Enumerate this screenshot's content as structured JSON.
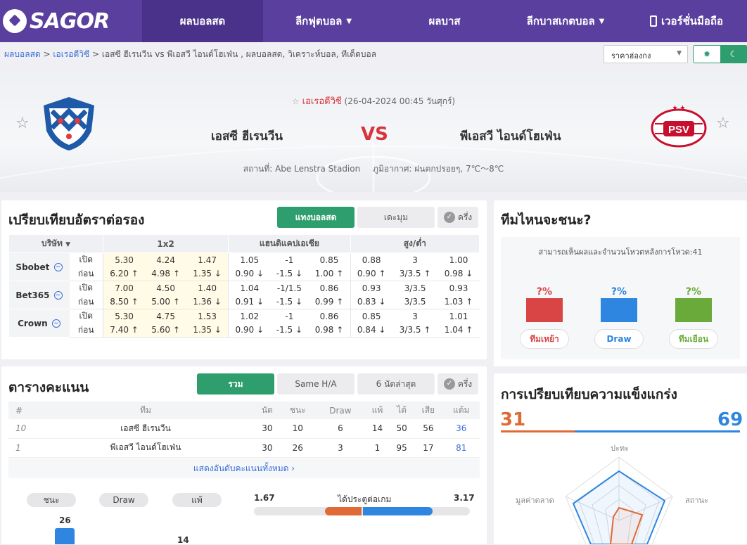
{
  "nav": {
    "logo": "SAGOR",
    "items": [
      {
        "label": "ผลบอลสด",
        "dropdown": false,
        "active": true
      },
      {
        "label": "ลีกฟุตบอล",
        "dropdown": true,
        "active": false
      },
      {
        "label": "ผลบาส",
        "dropdown": false,
        "active": false
      },
      {
        "label": "ลีกบาสเกตบอล",
        "dropdown": true,
        "active": false
      },
      {
        "label": "เวอร์ชั่นมือถือ",
        "dropdown": false,
        "active": false
      }
    ]
  },
  "breadcrumb": {
    "home": "ผลบอลสด",
    "league": "เอเรอดีวิซี",
    "rest": "> เอสซี ฮีเรนวีน vs พีเอสวี ไอนด์โฮเฟ่น , ผลบอลสด, วิเคราะห์บอล, ทีเด็ดบอล",
    "odds_type": "ราคาฮ่องกง"
  },
  "match": {
    "league": "เอเรอดีวิซี",
    "datetime": "(26-04-2024 00:45 วันศุกร์)",
    "home": "เอสซี ฮีเรนวีน",
    "away": "พีเอสวี ไอนด์โฮเฟ่น",
    "vs": "VS",
    "venue": "สถานที่: Abe Lenstra Stadion",
    "weather": "ภูมิอากาศ: ฝนตกปรอยๆ, 7℃～8℃",
    "home_crest_text": "SC Heerenveen",
    "away_crest_text": "PSV"
  },
  "odds": {
    "title": "เปรียบเทียบอัตราต่อรอง",
    "btn_live": "แทงบอลสด",
    "btn_more": "เดะมุม",
    "btn_half": "ครึ่ง",
    "headers": {
      "company": "บริษัท",
      "x12": "1x2",
      "handicap": "แฮนดิแคปเอเชีย",
      "ou": "สูง/ต่ำ"
    },
    "open_label": "เปิด",
    "close_label": "ก่อน",
    "rows": [
      {
        "book": "Sbobet",
        "open": [
          "5.30",
          "4.24",
          "1.47",
          "1.05",
          "-1",
          "0.85",
          "0.88",
          "3",
          "1.00"
        ],
        "close": [
          "6.20 ↑",
          "4.98 ↑",
          "1.35 ↓",
          "0.90 ↓",
          "-1.5 ↓",
          "1.00 ↑",
          "0.90 ↑",
          "3/3.5 ↑",
          "0.98 ↓"
        ],
        "dir": [
          "up",
          "up",
          "dn",
          "dn",
          "dn",
          "up",
          "up",
          "up",
          "dn"
        ]
      },
      {
        "book": "Bet365",
        "open": [
          "7.00",
          "4.50",
          "1.40",
          "1.04",
          "-1/1.5",
          "0.86",
          "0.93",
          "3/3.5",
          "0.93"
        ],
        "close": [
          "8.50 ↑",
          "5.00 ↑",
          "1.36 ↓",
          "0.91 ↓",
          "-1.5 ↓",
          "0.99 ↑",
          "0.83 ↓",
          "3/3.5",
          "1.03 ↑"
        ],
        "dir": [
          "up",
          "up",
          "dn",
          "dn",
          "dn",
          "up",
          "dn",
          "",
          "up"
        ]
      },
      {
        "book": "Crown",
        "open": [
          "5.30",
          "4.75",
          "1.53",
          "1.02",
          "-1",
          "0.86",
          "0.85",
          "3",
          "1.01"
        ],
        "close": [
          "7.40 ↑",
          "5.60 ↑",
          "1.35 ↓",
          "0.90 ↓",
          "-1.5 ↓",
          "0.98 ↑",
          "0.84 ↓",
          "3/3.5 ↑",
          "1.04 ↑"
        ],
        "dir": [
          "up",
          "up",
          "dn",
          "dn",
          "dn",
          "up",
          "dn",
          "up",
          "up"
        ]
      }
    ]
  },
  "standings": {
    "title": "ตารางคะแนน",
    "tabs": [
      "รวม",
      "Same H/A",
      "6 นัดล่าสุด"
    ],
    "half": "ครึ่ง",
    "headers": [
      "#",
      "ทีม",
      "นัด",
      "ชนะ",
      "Draw",
      "แพ้",
      "ได้",
      "เสีย",
      "แต้ม"
    ],
    "rows": [
      [
        "10",
        "เอสซี ฮีเรนวีน",
        "30",
        "10",
        "6",
        "14",
        "50",
        "56",
        "36"
      ],
      [
        "1",
        "พีเอสวี ไอนด์โฮเฟ่น",
        "30",
        "26",
        "3",
        "1",
        "95",
        "17",
        "81"
      ]
    ],
    "more": "แสดงอันดับคะแนนทั้งหมด ›"
  },
  "stats": {
    "pills": [
      "ชนะ",
      "Draw",
      "แพ้"
    ],
    "win_home": "26",
    "win_away": "14",
    "goals_label": "ได้ประตูต่อเกม",
    "goals_home": "1.67",
    "goals_away": "3.17"
  },
  "vote": {
    "title": "ทีมไหนจะชนะ?",
    "note": "สามารถเห็นผลและจำนวนโหวตหลังการโหวด:41",
    "pcts": [
      "?%",
      "?%",
      "?%"
    ],
    "buttons": [
      "ทีมเหย้า",
      "Draw",
      "ทีมเยือน"
    ],
    "colors": [
      "#d94545",
      "#2f86e0",
      "#6aaa3a"
    ]
  },
  "strength": {
    "title": "การเปรียบเทียบความแข็งแกร่ง",
    "home": "31",
    "away": "69",
    "home_share": 0.31,
    "axes": [
      "ปะทะ",
      "สถานะ",
      "มูลค่าตลาด"
    ],
    "colors": {
      "home": "#e06a35",
      "away": "#2f86e0"
    }
  }
}
